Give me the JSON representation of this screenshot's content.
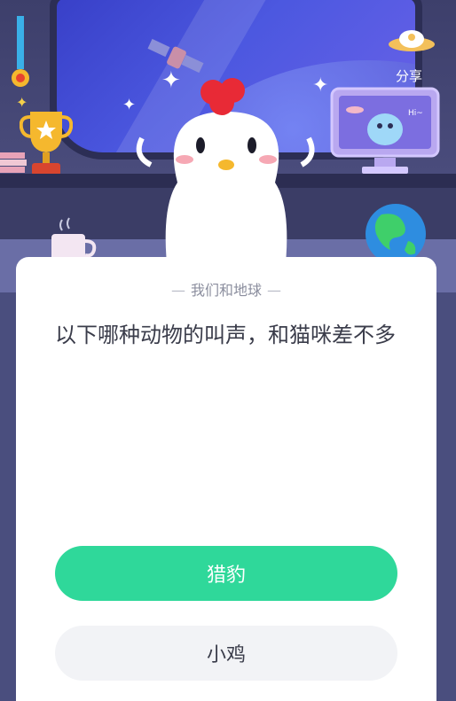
{
  "header": {
    "share_label": "分享"
  },
  "card": {
    "category": "我们和地球",
    "question": "以下哪种动物的叫声，和猫咪差不多"
  },
  "options": [
    {
      "label": "猎豹",
      "selected": true
    },
    {
      "label": "小鸡",
      "selected": false
    }
  ],
  "colors": {
    "option_selected": "#2fd89a",
    "option_default": "#f2f3f6",
    "scene_bg": "#4a4c7c"
  },
  "icons": {
    "share": "ufo-share-icon",
    "trophy": "trophy-icon",
    "medal": "medal-icon",
    "satellite": "satellite-icon",
    "monitor": "monitor-icon",
    "globe": "globe-icon",
    "mug": "mug-icon",
    "mascot": "chicken-mascot"
  }
}
